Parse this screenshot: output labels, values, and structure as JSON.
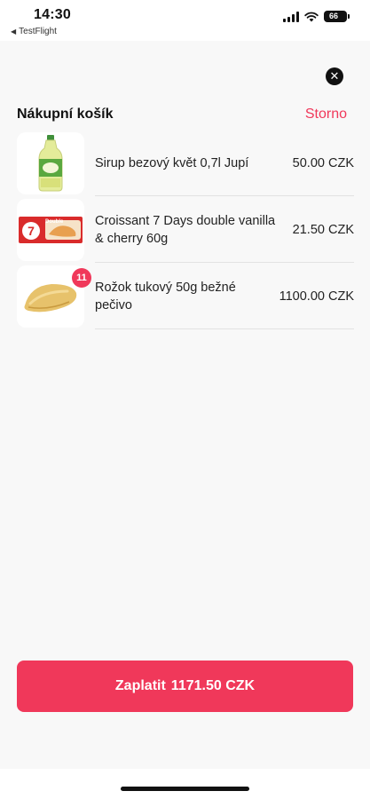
{
  "status_bar": {
    "time": "14:30",
    "back_app": "TestFlight",
    "battery": "66"
  },
  "cart": {
    "title": "Nákupní košík",
    "cancel_label": "Storno",
    "items": [
      {
        "name": "Sirup bezový květ 0,7l Jupí",
        "price": "50.00 CZK",
        "quantity_badge": ""
      },
      {
        "name": "Croissant 7 Days double vanilla & cherry 60g",
        "price": "21.50 CZK",
        "quantity_badge": ""
      },
      {
        "name": "Rožok tukový 50g bežné pečivo",
        "price": "1100.00 CZK",
        "quantity_badge": "11"
      }
    ],
    "pay_label": "Zaplatit",
    "pay_total": "1171.50 CZK"
  },
  "images": {
    "item_0": "syrup-bottle-image",
    "item_1": "croissant-package-image",
    "item_2": "bread-roll-image",
    "croissant_brand_text": "Double"
  },
  "colors": {
    "accent": "#f0385a",
    "sheet_background": "#f8f8f8"
  }
}
